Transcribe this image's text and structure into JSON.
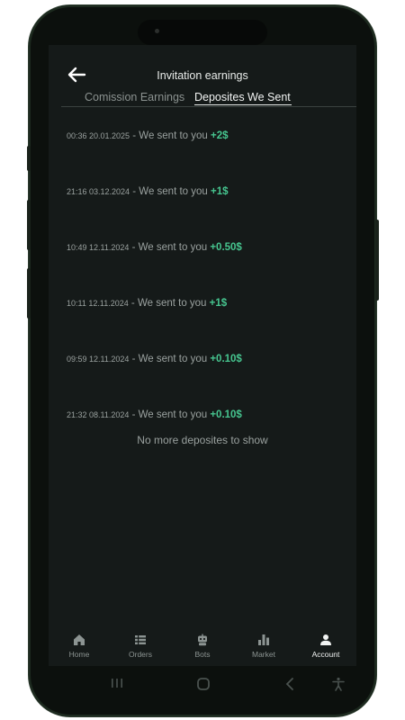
{
  "header": {
    "title": "Invitation earnings",
    "back_icon": "arrow-left-icon"
  },
  "tabs": [
    {
      "label": "Comission Earnings",
      "active": false
    },
    {
      "label": "Deposites We Sent",
      "active": true
    }
  ],
  "deposits": [
    {
      "timestamp": "00:36 20.01.2025",
      "message": " - We sent to you ",
      "amount": "+2$"
    },
    {
      "timestamp": "21:16 03.12.2024",
      "message": " - We sent to you ",
      "amount": "+1$"
    },
    {
      "timestamp": "10:49 12.11.2024",
      "message": " - We sent to you ",
      "amount": "+0.50$"
    },
    {
      "timestamp": "10:11 12.11.2024",
      "message": " - We sent to you ",
      "amount": "+1$"
    },
    {
      "timestamp": "09:59 12.11.2024",
      "message": " - We sent to you ",
      "amount": "+0.10$"
    },
    {
      "timestamp": "21:32 08.11.2024",
      "message": " - We sent to you ",
      "amount": "+0.10$"
    }
  ],
  "empty_message": "No more deposites to show",
  "bottom_nav": [
    {
      "label": "Home",
      "icon": "home-icon",
      "active": false
    },
    {
      "label": "Orders",
      "icon": "list-icon",
      "active": false
    },
    {
      "label": "Bots",
      "icon": "robot-icon",
      "active": false
    },
    {
      "label": "Market",
      "icon": "bar-chart-icon",
      "active": false
    },
    {
      "label": "Account",
      "icon": "user-icon",
      "active": true
    }
  ],
  "system_nav": [
    "recents-icon",
    "home-circle-icon",
    "back-chevron-icon",
    "accessibility-icon"
  ],
  "colors": {
    "background": "#151a19",
    "amount_green": "#46c58f",
    "text_muted": "#9aa19f",
    "text_primary": "#e9ecea"
  }
}
